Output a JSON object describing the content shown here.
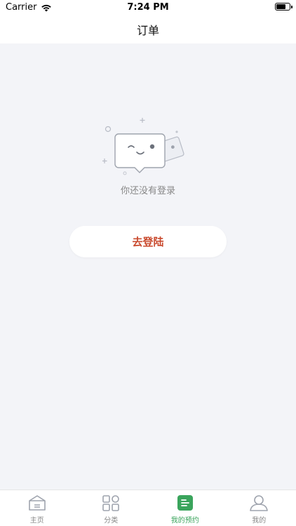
{
  "status_bar": {
    "carrier": "Carrier",
    "time": "7:24 PM"
  },
  "nav": {
    "title": "订单"
  },
  "empty": {
    "message": "你还没有登录"
  },
  "login_button": {
    "label": "去登陆"
  },
  "tabs": [
    {
      "label": "主页",
      "icon": "home-icon",
      "active": false
    },
    {
      "label": "分类",
      "icon": "category-icon",
      "active": false
    },
    {
      "label": "我的预约",
      "icon": "booking-icon",
      "active": true
    },
    {
      "label": "我的",
      "icon": "profile-icon",
      "active": false
    }
  ],
  "colors": {
    "accent": "#3aa45c",
    "login_text": "#c94a2e",
    "background": "#f3f4f8"
  }
}
